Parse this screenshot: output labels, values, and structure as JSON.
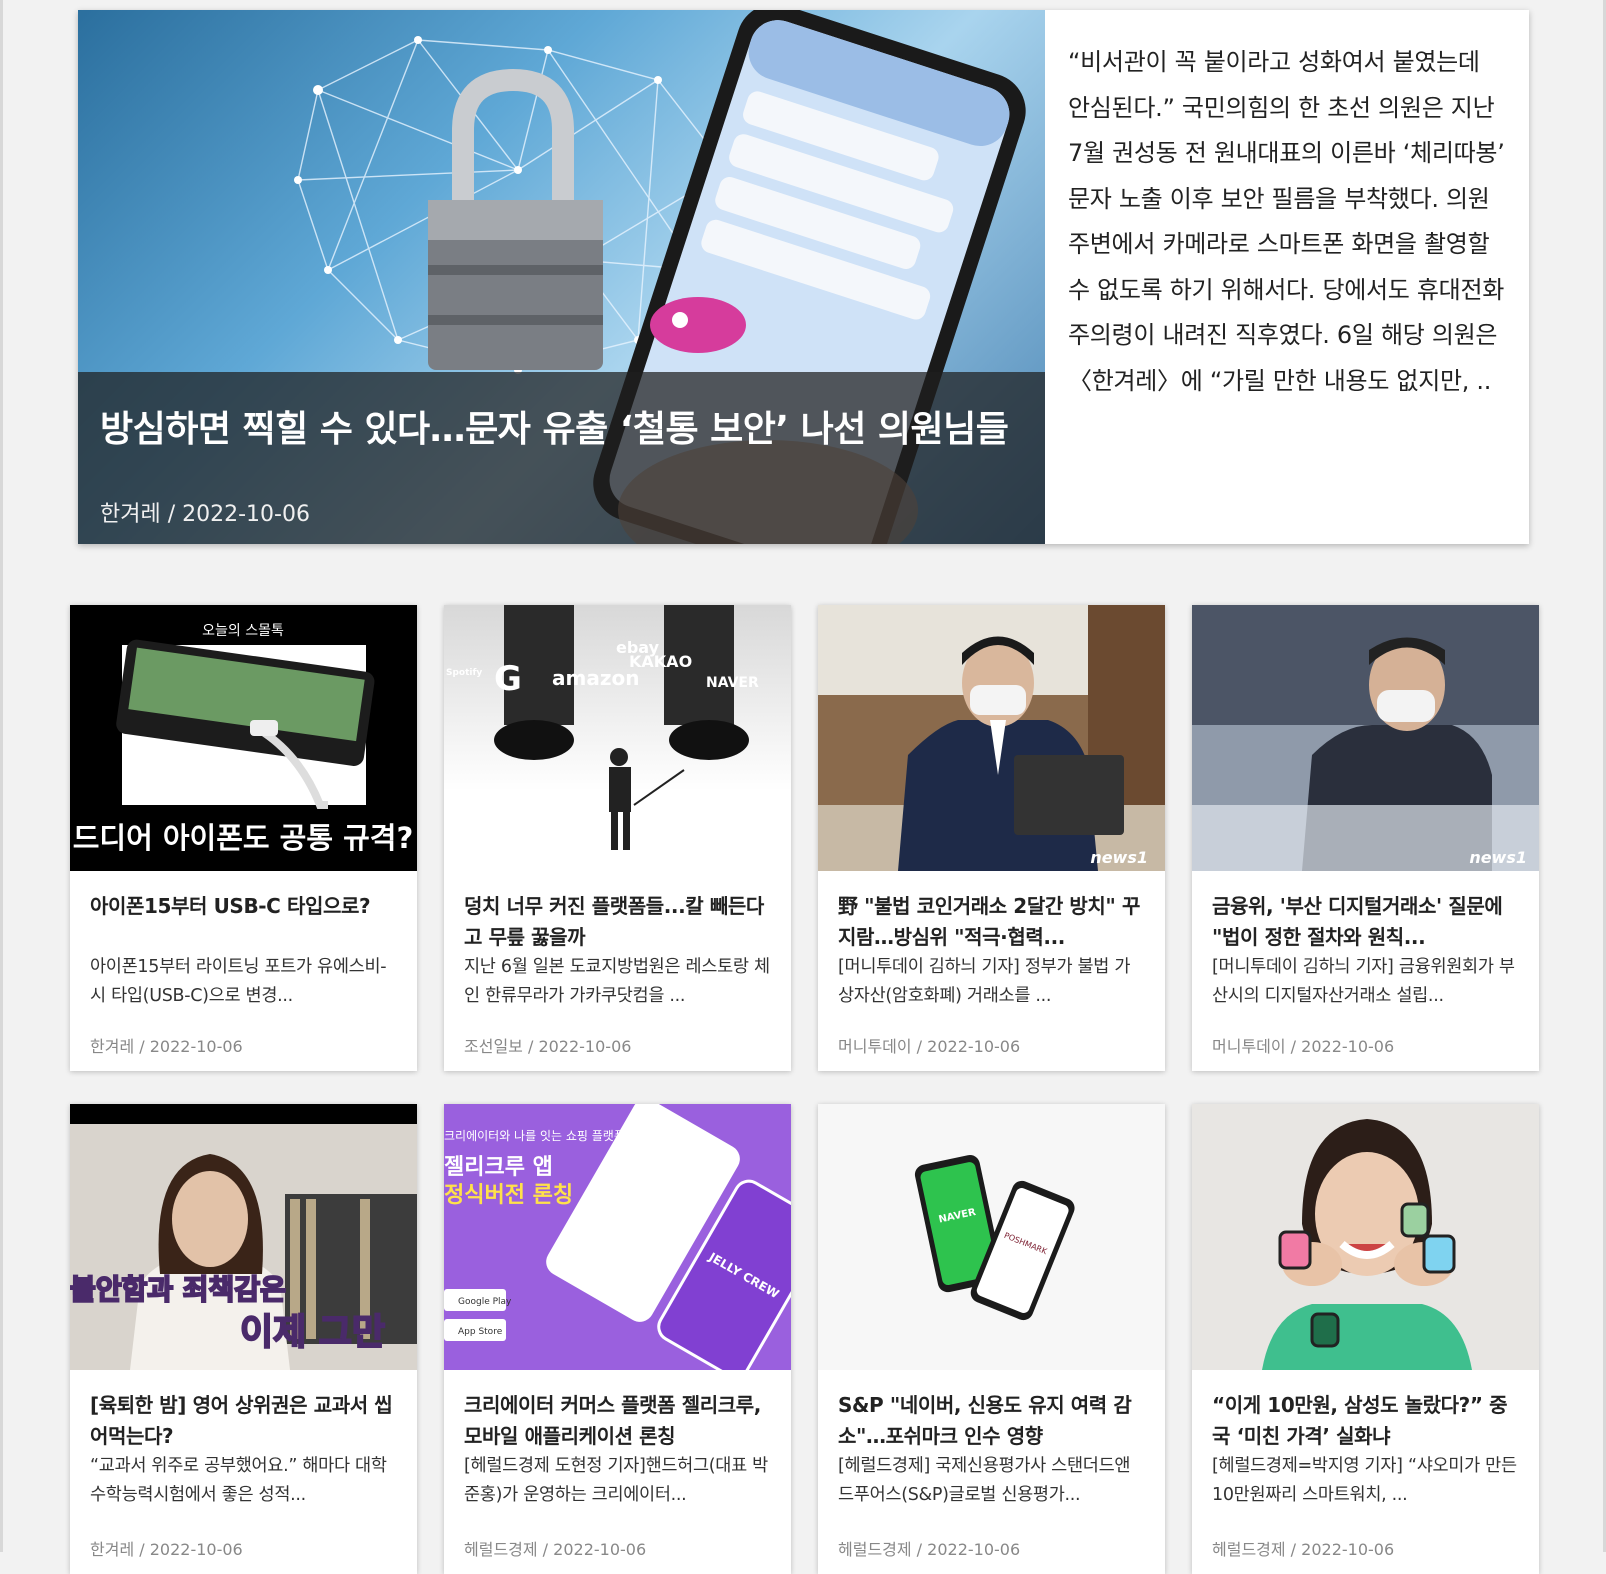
{
  "hero": {
    "title": "방심하면 찍힐 수 있다…문자 유출 ‘철통 보안’ 나선 의원님들",
    "meta": "한겨레 / 2022-10-06",
    "summary": "“비서관이 꼭 붙이라고 성화여서 붙였는데 안심된다.” 국민의힘의 한 초선 의원은 지난 7월 권성동 전 원내대표의 이른바 ‘체리따봉’ 문자 노출 이후 보안 필름을 부착했다. 의원 주변에서 카메라로 스마트폰 화면을 촬영할 수 없도록 하기 위해서다. 당에서도 휴대전화 주의령이 내려진 직후였다. 6일 해당 의원은 〈한겨레〉에 “가릴 만한 내용도 없지만, ..",
    "image_icon": "smartphone-lock-image"
  },
  "thumb_text": {
    "c1_caption": "드디어 아이폰도 공통 규격?",
    "c1_header": "오늘의 스몰톡",
    "c2_brands": [
      "ebay",
      "amazon",
      "KAKAO",
      "NAVER",
      "G",
      "Spotify"
    ],
    "c3_watermark": "news1",
    "c4_watermark": "news1",
    "c5_caption1": "불안함과 죄책감은",
    "c5_caption2": "이제 그만",
    "c6_header": "크리에이터와 나를 잇는 쇼핑 플랫폼",
    "c6_title1": "젤리크루 앱",
    "c6_title2": "정식버전 론칭",
    "c6_store1": "Google Play",
    "c6_store2": "App Store",
    "c6_brand": "JELLY CREW",
    "c7_brand1": "NAVER",
    "c7_brand2": "POSHMARK"
  },
  "cards": [
    {
      "title": "아이폰15부터 USB-C 타입으로?",
      "desc": "아이폰15부터 라이트닝 포트가 유에스비-시 타입(USB-C)으로 변경...",
      "meta": "한겨레 / 2022-10-06"
    },
    {
      "title": "덩치 너무 커진 플랫폼들...칼 빼든다고 무릎 꿇을까",
      "desc": "지난 6월 일본 도쿄지방법원은 레스토랑 체인 한류무라가 가카쿠닷컴을 ...",
      "meta": "조선일보 / 2022-10-06"
    },
    {
      "title": "野 \"불법 코인거래소 2달간 방치\" 꾸지람…방심위 \"적극·협력...",
      "desc": "[머니투데이 김하늬 기자] 정부가 불법 가상자산(암호화폐) 거래소를 ...",
      "meta": "머니투데이 / 2022-10-06"
    },
    {
      "title": "금융위, '부산 디지털거래소' 질문에 \"법이 정한 절차와 원칙...",
      "desc": "[머니투데이 김하늬 기자] 금융위원회가 부산시의 디지털자산거래소 설립...",
      "meta": "머니투데이 / 2022-10-06"
    },
    {
      "title": "[육퇴한 밤] 영어 상위권은 교과서 씹어먹는다?",
      "desc": "“교과서 위주로 공부했어요.” 해마다 대학수학능력시험에서 좋은 성적...",
      "meta": "한겨레 / 2022-10-06"
    },
    {
      "title": "크리에이터 커머스 플랫폼 젤리크루, 모바일 애플리케이션 론칭",
      "desc": "[헤럴드경제 도현정 기자]핸드허그(대표 박준홍)가 운영하는 크리에이터...",
      "meta": "헤럴드경제 / 2022-10-06"
    },
    {
      "title": "S&P \"네이버, 신용도 유지 여력 감소\"…포쉬마크 인수 영향",
      "desc": "[헤럴드경제] 국제신용평가사 스탠더드앤드푸어스(S&P)글로벌 신용평가...",
      "meta": "헤럴드경제 / 2022-10-06"
    },
    {
      "title": "“이게 10만원, 삼성도 놀랐다?” 중국 ‘미친 가격’ 실화냐",
      "desc": "[헤럴드경제=박지영 기자] “샤오미가 만든 10만원짜리 스마트워치, ...",
      "meta": "헤럴드경제 / 2022-10-06"
    }
  ]
}
